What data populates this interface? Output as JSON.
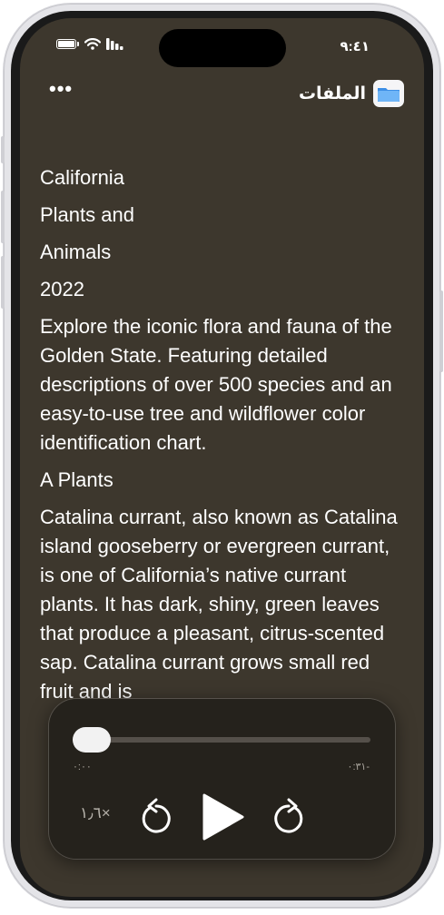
{
  "status_bar": {
    "time": "٩:٤١"
  },
  "nav": {
    "title": "الملفات",
    "more": "•••"
  },
  "document": {
    "paragraphs": [
      "California",
      "Plants and",
      "Animals",
      "2022",
      "Explore the iconic flora and fauna of the Golden State. Featuring detailed descriptions of over 500 species and an easy-to-use tree and wildflower color identification chart.",
      "A Plants",
      "Catalina currant, also known as Catalina island gooseberry or evergreen currant, is one of California’s native currant plants. It has dark, shiny, green leaves that produce a pleasant, citrus-scented sap. Catalina currant grows small red fruit and is"
    ]
  },
  "player": {
    "elapsed": "٠:٠٠",
    "remaining": "-٠:٣١",
    "speed": "١٫٦×",
    "progress": 0.0
  },
  "colors": {
    "background": "#3d372d",
    "player_bg": "#24211c",
    "text": "#ffffff",
    "folder_blue": "#5aa7f0"
  }
}
